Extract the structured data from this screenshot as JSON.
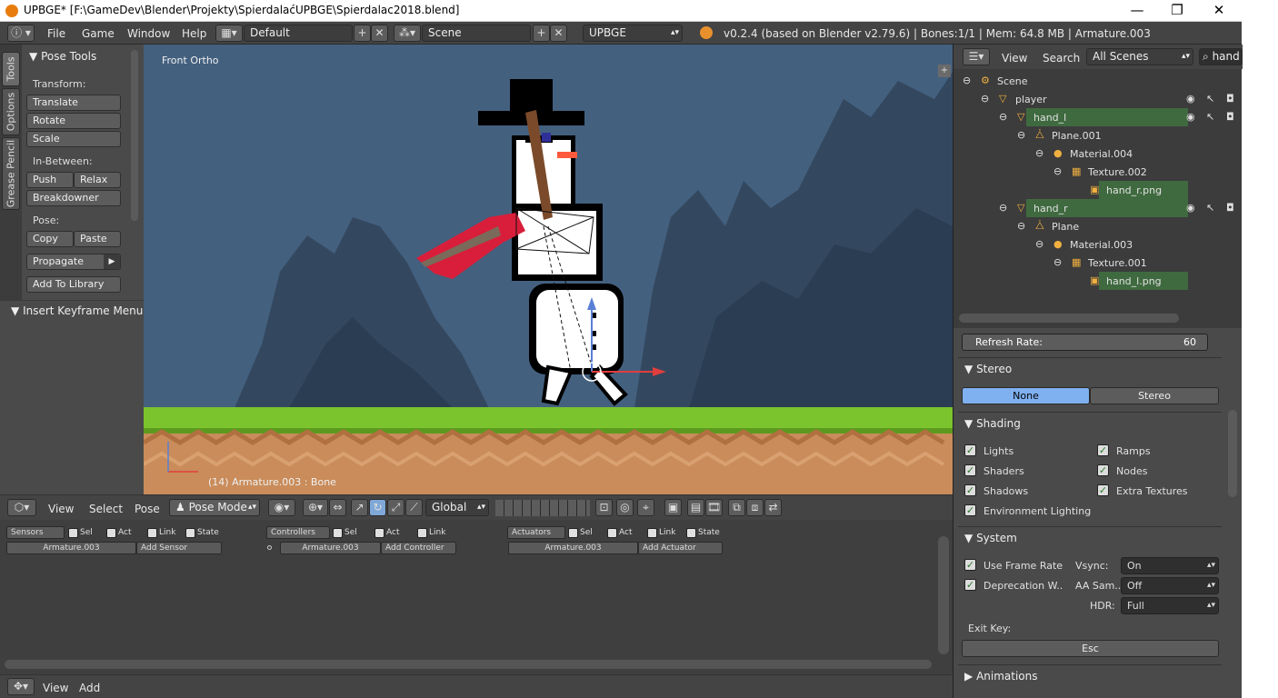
{
  "window": {
    "title": "UPBGE* [F:\\GameDev\\Blender\\Projekty\\SpierdalaćUPBGE\\Spierdalac2018.blend]",
    "min": "—",
    "max": "❐",
    "close": "✕"
  },
  "infobar": {
    "menus": [
      "File",
      "Game",
      "Window",
      "Help"
    ],
    "layout": "Default",
    "scene": "Scene",
    "engine": "UPBGE",
    "stats": "v0.2.4 (based on Blender v2.79.6) | Bones:1/1 | Mem: 64.8 MB | Armature.003"
  },
  "tool_tabs": [
    "Tools",
    "Options",
    "Grease Pencil"
  ],
  "tools": {
    "title": "Pose Tools",
    "transform_label": "Transform:",
    "translate": "Translate",
    "rotate": "Rotate",
    "scale": "Scale",
    "inbetween_label": "In-Between:",
    "push": "Push",
    "relax": "Relax",
    "breakdowner": "Breakdowner",
    "pose_label": "Pose:",
    "copy": "Copy",
    "paste": "Paste",
    "propagate": "Propagate",
    "add_library": "Add To Library",
    "keyframe_menu": "Insert Keyframe Menu"
  },
  "viewport": {
    "view_name": "Front Ortho",
    "status": "(14) Armature.003 : Bone"
  },
  "view3d_header": {
    "menus": [
      "View",
      "Select",
      "Pose"
    ],
    "mode": "Pose Mode",
    "orientation": "Global"
  },
  "logic": {
    "sensors": "Sensors",
    "controllers": "Controllers",
    "actuators": "Actuators",
    "sel": "Sel",
    "act": "Act",
    "link": "Link",
    "state": "State",
    "object": "Armature.003",
    "add_sensor": "Add Sensor",
    "add_controller": "Add Controller",
    "add_actuator": "Add Actuator"
  },
  "bottombar": {
    "menus": [
      "View",
      "Add"
    ]
  },
  "outliner": {
    "menus": [
      "View",
      "Search"
    ],
    "filter": "All Scenes",
    "search_value": "hand",
    "rows": [
      {
        "label": "Scene",
        "indent": 0
      },
      {
        "label": "player",
        "indent": 1
      },
      {
        "label": "hand_l",
        "indent": 2
      },
      {
        "label": "Plane.001",
        "indent": 3
      },
      {
        "label": "Material.004",
        "indent": 4
      },
      {
        "label": "Texture.002",
        "indent": 5
      },
      {
        "label": "hand_r.png",
        "indent": 6
      },
      {
        "label": "hand_r",
        "indent": 2
      },
      {
        "label": "Plane",
        "indent": 3
      },
      {
        "label": "Material.003",
        "indent": 4
      },
      {
        "label": "Texture.001",
        "indent": 5
      },
      {
        "label": "hand_l.png",
        "indent": 6
      }
    ]
  },
  "props": {
    "refresh_label": "Refresh Rate:",
    "refresh_value": "60",
    "stereo_title": "Stereo",
    "stereo_none": "None",
    "stereo_stereo": "Stereo",
    "shading_title": "Shading",
    "lights": "Lights",
    "ramps": "Ramps",
    "shaders": "Shaders",
    "nodes": "Nodes",
    "shadows": "Shadows",
    "extra_textures": "Extra Textures",
    "env_lighting": "Environment Lighting",
    "system_title": "System",
    "use_frame_rate": "Use Frame Rate",
    "vsync_label": "Vsync:",
    "vsync_value": "On",
    "deprecation": "Deprecation W..",
    "aa_label": "AA Sam..",
    "aa_value": "Off",
    "hdr_label": "HDR:",
    "hdr_value": "Full",
    "exit_label": "Exit Key:",
    "exit_value": "Esc",
    "animations_title": "Animations"
  },
  "colors": {
    "sky": "#44607f",
    "grass": "#7bc42e",
    "dirt": "#c98c5a",
    "highlight_green": "#3f6a3f",
    "active_blue": "#7fb0ef"
  }
}
